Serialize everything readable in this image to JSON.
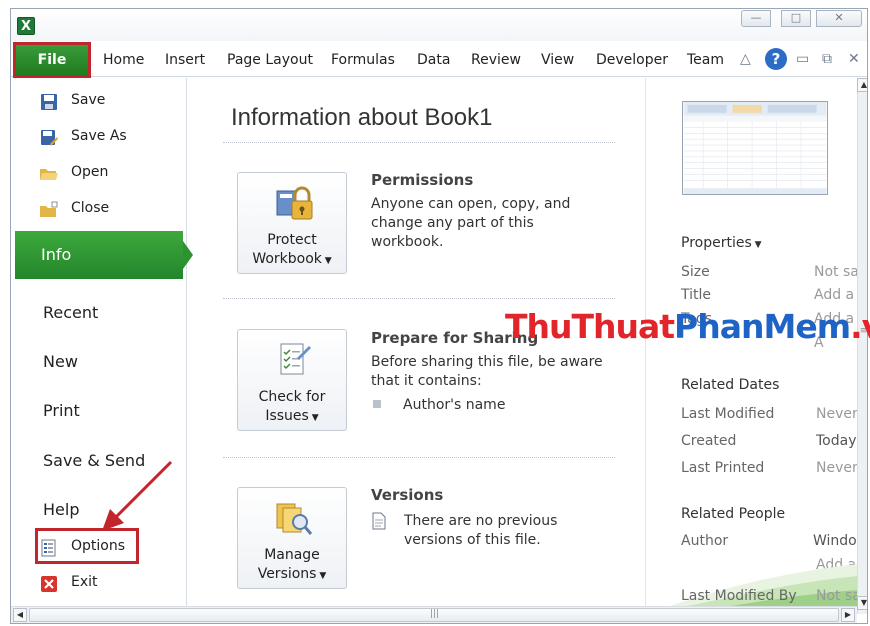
{
  "ribbon": {
    "file": "File",
    "tabs": [
      "Home",
      "Insert",
      "Page Layout",
      "Formulas",
      "Data",
      "Review",
      "View",
      "Developer",
      "Team"
    ],
    "help": "?"
  },
  "nav": {
    "save": "Save",
    "save_as": "Save As",
    "open": "Open",
    "close": "Close",
    "info": "Info",
    "recent": "Recent",
    "new": "New",
    "print": "Print",
    "save_send": "Save & Send",
    "help": "Help",
    "options": "Options",
    "exit": "Exit"
  },
  "info": {
    "title": "Information about Book1",
    "permissions": {
      "button_line1": "Protect",
      "button_line2": "Workbook",
      "heading": "Permissions",
      "text": [
        "Anyone can open, copy, and",
        "change any part of this",
        "workbook."
      ]
    },
    "prepare": {
      "button_line1": "Check for",
      "button_line2": "Issues",
      "heading": "Prepare for Sharing",
      "text": [
        "Before sharing this file, be aware",
        "that it contains:"
      ],
      "bullet": "Author's name"
    },
    "versions": {
      "button_line1": "Manage",
      "button_line2": "Versions",
      "heading": "Versions",
      "text": [
        "There are no previous",
        "versions of this file."
      ]
    }
  },
  "properties": {
    "heading": "Properties",
    "rows": [
      {
        "label": "Size",
        "value": "Not sa"
      },
      {
        "label": "Title",
        "value": "Add a"
      },
      {
        "label": "Tags",
        "value": "Add a"
      },
      {
        "label": "",
        "value": "A"
      }
    ],
    "related_dates": {
      "heading": "Related Dates",
      "rows": [
        {
          "label": "Last Modified",
          "value": "Never"
        },
        {
          "label": "Created",
          "value": "Today,"
        },
        {
          "label": "Last Printed",
          "value": "Never"
        }
      ]
    },
    "related_people": {
      "heading": "Related People",
      "author_label": "Author",
      "author_value": "Windo",
      "add_author": "Add a",
      "last_modified_by_label": "Last Modified By",
      "last_modified_by_value": "Not sa"
    }
  },
  "watermark": {
    "part1": "ThuThuat",
    "part2": "PhanMem",
    "part3": ".vn"
  },
  "colors": {
    "accent_green": "#2e9231",
    "highlight_red": "#c0262c",
    "watermark_red": "#e1252b",
    "watermark_blue": "#1e63c6"
  }
}
